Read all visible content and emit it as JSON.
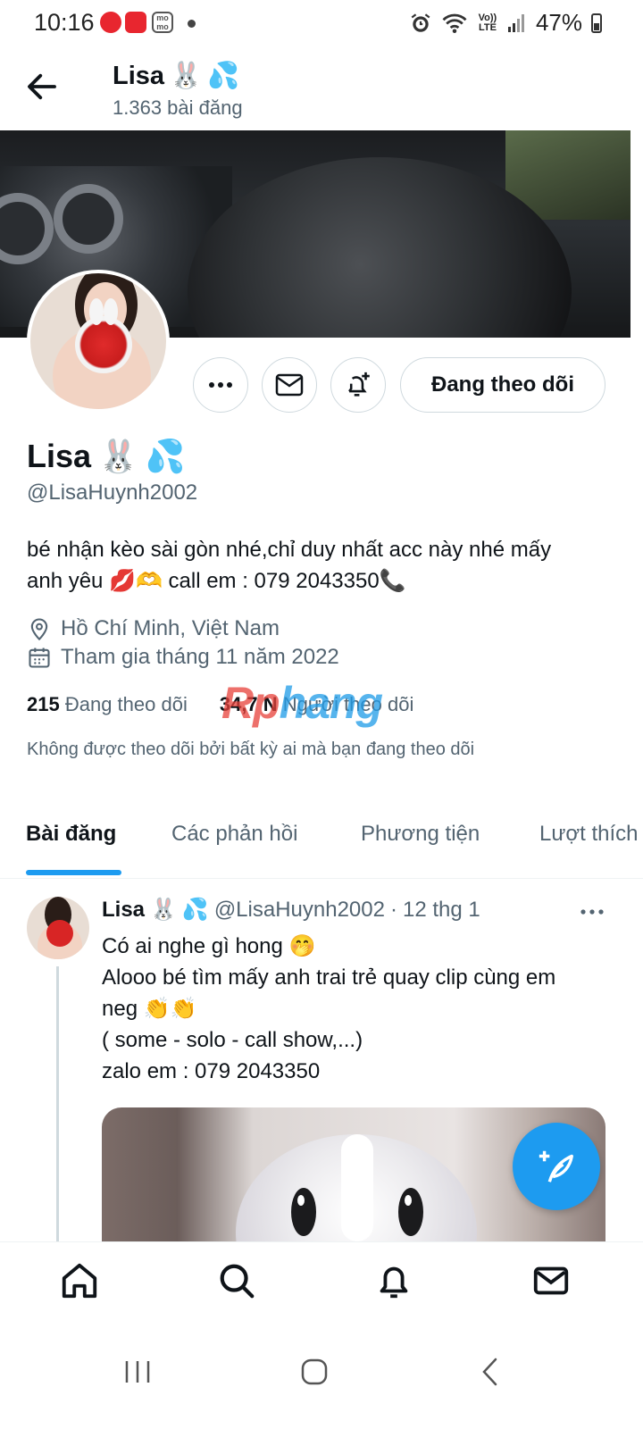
{
  "status_bar": {
    "time": "10:16",
    "volte": "Vo)) LTE",
    "battery": "47%"
  },
  "header": {
    "title": "Lisa",
    "post_count": "1.363 bài đăng"
  },
  "profile": {
    "name": "Lisa",
    "handle": "@LisaHuynh2002",
    "bio_line1": "bé nhận kèo sài gòn nhé,chỉ duy nhất acc này nhé mấy",
    "bio_line2_a": "anh yêu",
    "bio_line2_b": "call em : 079 2043350",
    "location": "Hồ Chí Minh, Việt Nam",
    "joined": "Tham gia tháng 11 năm 2022",
    "following_count": "215",
    "following_label": "Đang theo dõi",
    "followers_count": "34,7 N",
    "followers_label": "Người theo dõi",
    "not_followed_note": "Không được theo dõi bởi bất kỳ ai mà bạn đang theo dõi",
    "follow_button": "Đang theo dõi"
  },
  "watermark": {
    "part1": "Rp",
    "part2": "hang"
  },
  "tabs": [
    {
      "label": "Bài đăng",
      "active": true
    },
    {
      "label": "Các phản hồi",
      "active": false
    },
    {
      "label": "Phương tiện",
      "active": false
    },
    {
      "label": "Lượt thích",
      "active": false
    }
  ],
  "tweet": {
    "name": "Lisa",
    "handle": "@LisaHuynh2002",
    "separator": "·",
    "date": "12 thg 1",
    "line1": "Có ai nghe gì hong",
    "line2": "Alooo bé tìm mấy anh trai trẻ quay clip cùng em",
    "line3": "neg",
    "line4": "( some - solo - call show,...)",
    "line5": "zalo em : 079 2043350"
  },
  "emoji": {
    "rabbit": "🐰",
    "sweat": "💦",
    "lips": "💋",
    "heart_hands": "🫶",
    "phone": "📞",
    "hand_over_mouth": "🤭",
    "clap": "👏👏"
  },
  "colors": {
    "accent": "#1d9bf0",
    "text_primary": "#0f1419",
    "text_secondary": "#536471",
    "border": "#cfd9de"
  }
}
